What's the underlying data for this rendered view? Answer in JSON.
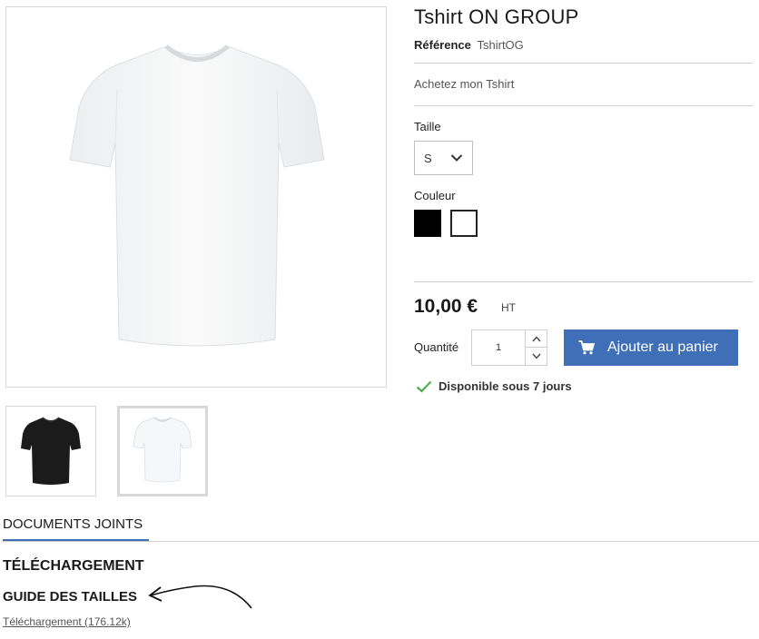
{
  "product": {
    "title": "Tshirt ON GROUP",
    "reference_label": "Référence",
    "reference_value": "TshirtOG",
    "description": "Achetez mon Tshirt",
    "size_label": "Taille",
    "size_selected": "S",
    "color_label": "Couleur",
    "colors": [
      "#000000",
      "#ffffff"
    ],
    "price": "10,00 €",
    "tax": "HT",
    "quantity_label": "Quantité",
    "quantity_value": "1",
    "add_to_cart": "Ajouter au panier",
    "availability": "Disponible sous 7 jours"
  },
  "tabs": {
    "attachments": "DOCUMENTS JOINTS"
  },
  "attachments": {
    "heading": "TÉLÉCHARGEMENT",
    "item_title": "GUIDE DES TAILLES",
    "link": "Téléchargement (176.12k)"
  },
  "colors": {
    "accent": "#3f6fb6",
    "check": "#4caf50"
  }
}
